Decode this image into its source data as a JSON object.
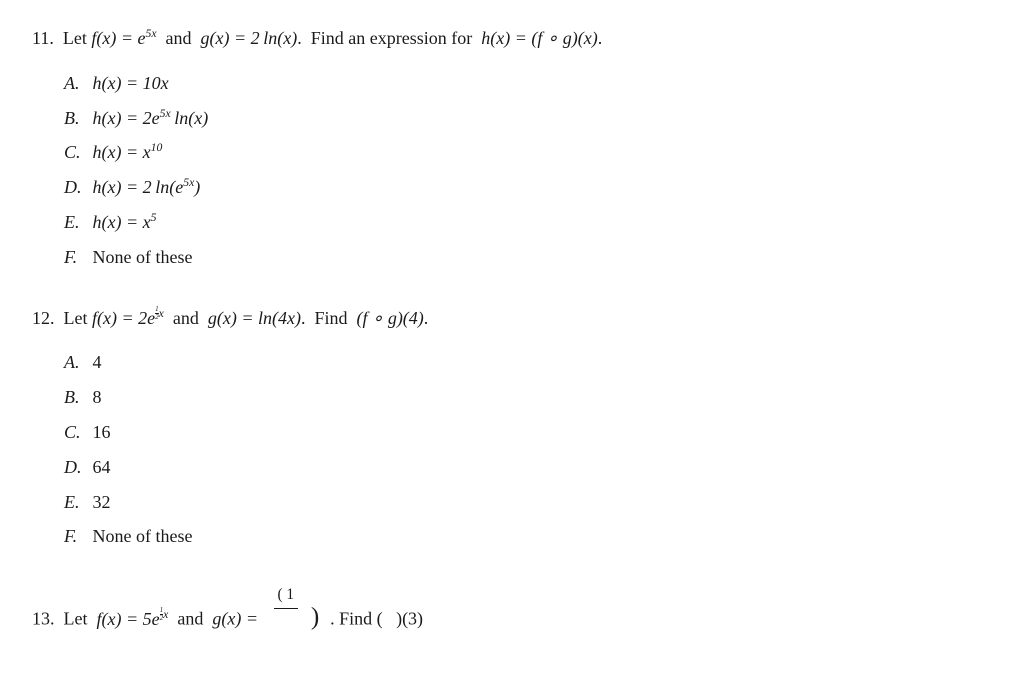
{
  "questions": [
    {
      "id": "q11",
      "number": "11.",
      "prompt_parts": [
        "Let ",
        "f(x) = e^{5x}",
        " and ",
        "g(x) = 2 ln(x)",
        ". Find an expression for ",
        "h(x) = (f ∘ g)(x)",
        "."
      ],
      "answers": [
        {
          "label": "A.",
          "text": "h(x) = 10x"
        },
        {
          "label": "B.",
          "text": "h(x) = 2e^{5x} ln(x)"
        },
        {
          "label": "C.",
          "text": "h(x) = x^{10}"
        },
        {
          "label": "D.",
          "text": "h(x) = 2 ln(e^{5x})"
        },
        {
          "label": "E.",
          "text": "h(x) = x^5"
        },
        {
          "label": "F.",
          "text": "None of these"
        }
      ]
    },
    {
      "id": "q12",
      "number": "12.",
      "prompt_parts": [
        "Let ",
        "f(x) = 2e^{(1/2)x}",
        " and ",
        "g(x) = ln(4x)",
        ". Find ",
        "(f ∘ g)(4)",
        "."
      ],
      "answers": [
        {
          "label": "A.",
          "text": "4"
        },
        {
          "label": "B.",
          "text": "8"
        },
        {
          "label": "C.",
          "text": "16"
        },
        {
          "label": "D.",
          "text": "64"
        },
        {
          "label": "E.",
          "text": "32"
        },
        {
          "label": "F.",
          "text": "None of these"
        }
      ]
    }
  ],
  "partial_q13": {
    "number": "13.",
    "text_prefix": "Let  f(x) = 5",
    "exponent": "1/2 x",
    "text_middle": " and  g(x) =",
    "paren_open": "( 1",
    "paren_body": " )",
    "text_suffix": ". Find (   )(3)"
  }
}
